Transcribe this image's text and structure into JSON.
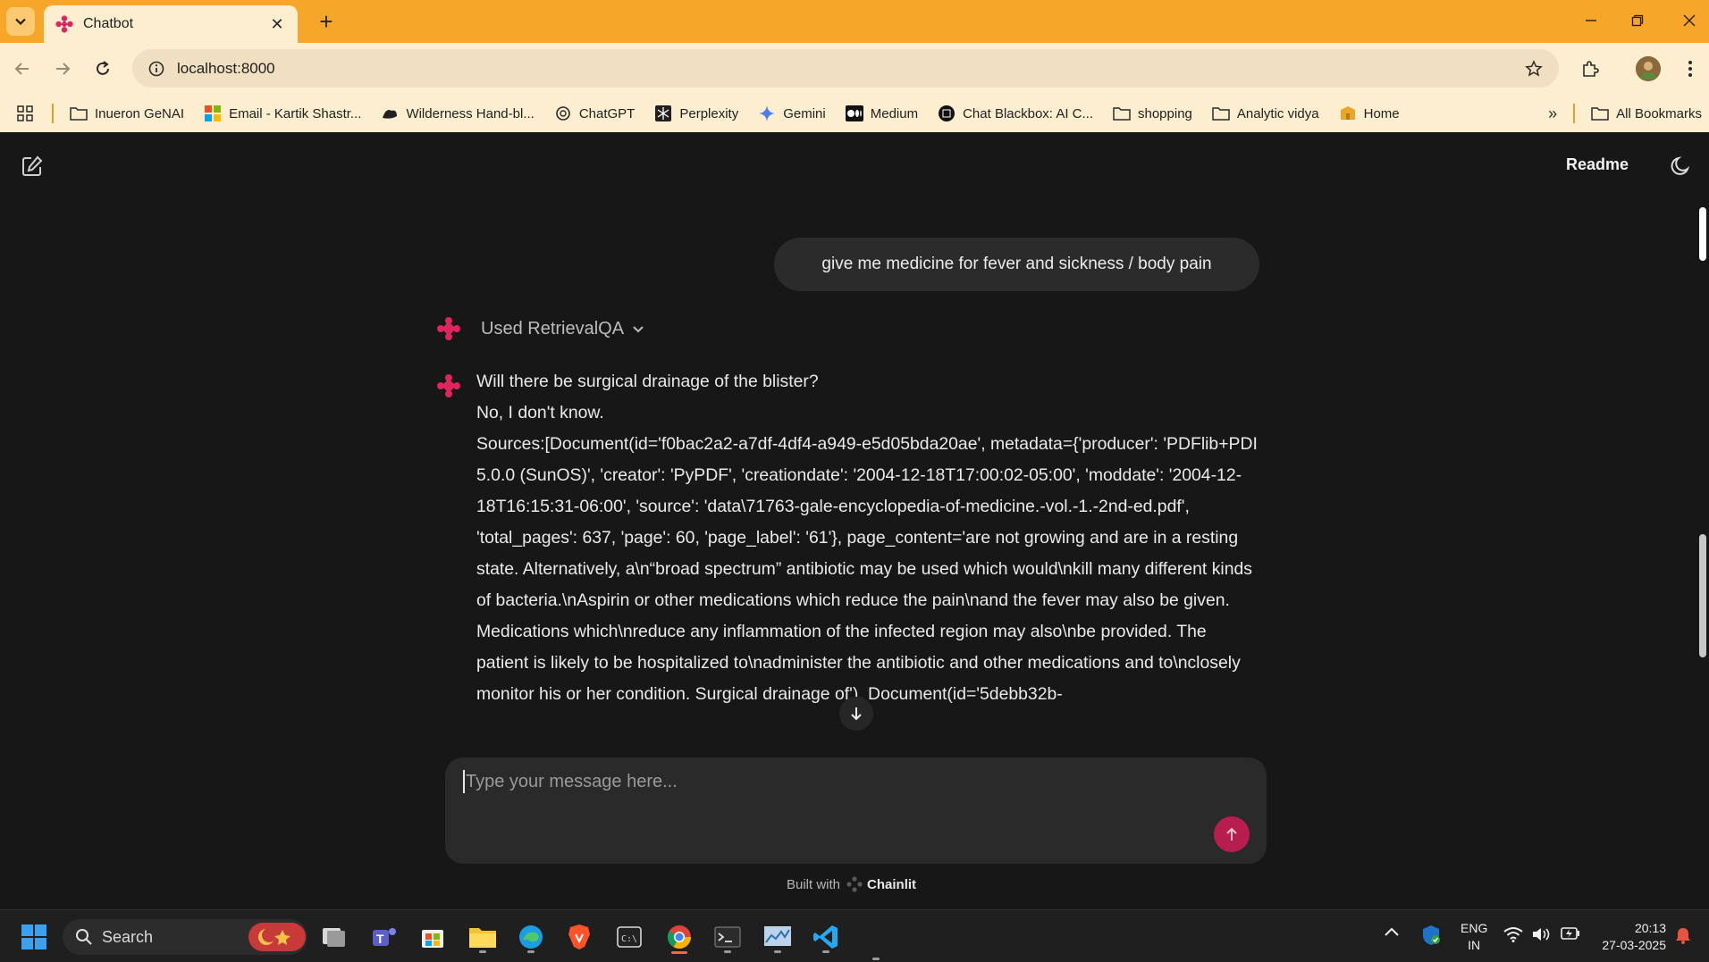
{
  "browser": {
    "tab_title": "Chatbot",
    "url": "localhost:8000",
    "bookmarks": [
      {
        "label": "Inueron GeNAI",
        "icon": "folder-icon"
      },
      {
        "label": "Email - Kartik Shastr...",
        "icon": "microsoft-icon"
      },
      {
        "label": "Wilderness Hand-bl...",
        "icon": "site-icon"
      },
      {
        "label": "ChatGPT",
        "icon": "chatgpt-icon"
      },
      {
        "label": "Perplexity",
        "icon": "perplexity-icon"
      },
      {
        "label": "Gemini",
        "icon": "gemini-icon"
      },
      {
        "label": "Medium",
        "icon": "medium-icon"
      },
      {
        "label": "Chat Blackbox: AI C...",
        "icon": "blackbox-icon"
      },
      {
        "label": "shopping",
        "icon": "folder-icon"
      },
      {
        "label": "Analytic vidya",
        "icon": "folder-icon"
      },
      {
        "label": "Home",
        "icon": "home-box-icon"
      }
    ],
    "all_bookmarks_label": "All Bookmarks"
  },
  "app": {
    "readme_label": "Readme",
    "user_message": "give me medicine for fever and sickness / body pain",
    "step_label": "Used RetrievalQA",
    "answer_lines": [
      "Will there be surgical drainage of the blister?",
      "No, I don't know.",
      "Sources:[Document(id='f0bac2a2-a7df-4df4-a949-e5d05bda20ae', metadata={'producer': 'PDFlib+PDI 5.0.0 (SunOS)', 'creator': 'PyPDF', 'creationdate': '2004-12-18T17:00:02-05:00', 'moddate': '2004-12-18T16:15:31-06:00', 'source': 'data\\71763-gale-encyclopedia-of-medicine.-vol.-1.-2nd-ed.pdf', 'total_pages': 637, 'page': 60, 'page_label': '61'}, page_content='are not growing and are in a resting state. Alternatively, a\\n“broad spectrum” antibiotic may be used which would\\nkill many different kinds of bacteria.\\nAspirin or other medications which reduce the pain\\nand the fever may also be given. Medications which\\nreduce any inflammation of the infected region may also\\nbe provided. The patient is likely to be hospitalized to\\nadminister the antibiotic and other medications and to\\nclosely monitor his or her condition. Surgical drainage of'), Document(id='5debb32b-"
    ],
    "composer_placeholder": "Type your message here...",
    "built_with_label": "Built with",
    "built_with_brand": "Chainlit",
    "accent_color": "#e0255e"
  },
  "taskbar": {
    "search_label": "Search",
    "language_line1": "ENG",
    "language_line2": "IN",
    "time": "20:13",
    "date": "27-03-2025"
  }
}
